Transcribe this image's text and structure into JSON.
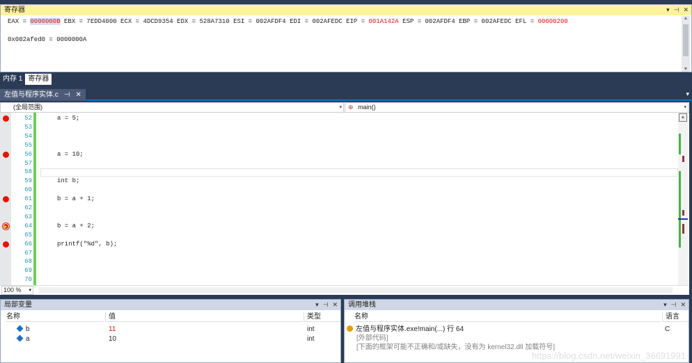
{
  "register_panel": {
    "title": "寄存器",
    "line1_segments": [
      {
        "text": "EAX = ",
        "style": "normal"
      },
      {
        "text": "0000000B",
        "style": "sel"
      },
      {
        "text": " EBX = 7EDD4000 ECX = 4DCD9354 EDX = 528A7310 ESI = 002AFDF4 EDI = 002AFEDC EIP = ",
        "style": "normal"
      },
      {
        "text": "001A142A",
        "style": "chg"
      },
      {
        "text": " ESP = 002AFDF4 EBP = 002AFEDC EFL = ",
        "style": "normal"
      },
      {
        "text": "00000200",
        "style": "chg"
      }
    ],
    "line2": "0x002afed0 = 0000000A"
  },
  "bottom_tabs": [
    "内存 1",
    "寄存器"
  ],
  "document_tab": {
    "label": "左值与程序实体.c",
    "pin": "⊣",
    "close": "✕"
  },
  "navbar": {
    "scope": "(全局范围)",
    "function": "main()"
  },
  "editor": {
    "lines": [
      {
        "num": "52",
        "code": "a = 5;",
        "bp": "bp"
      },
      {
        "num": "53",
        "code": "",
        "bp": ""
      },
      {
        "num": "54",
        "code": "",
        "bp": ""
      },
      {
        "num": "55",
        "code": "",
        "bp": ""
      },
      {
        "num": "56",
        "code": "a = 10;",
        "bp": "bp"
      },
      {
        "num": "57",
        "code": "",
        "bp": ""
      },
      {
        "num": "58",
        "code": "",
        "bp": ""
      },
      {
        "num": "59",
        "code": "int b;",
        "bp": ""
      },
      {
        "num": "60",
        "code": "",
        "bp": ""
      },
      {
        "num": "61",
        "code": "b = a + 1;",
        "bp": "bp"
      },
      {
        "num": "62",
        "code": "",
        "bp": ""
      },
      {
        "num": "63",
        "code": "",
        "bp": ""
      },
      {
        "num": "64",
        "code": "b = a + 2;",
        "bp": "cur"
      },
      {
        "num": "65",
        "code": "",
        "bp": ""
      },
      {
        "num": "66",
        "code": "printf(\"%d\", b);",
        "bp": "bp"
      },
      {
        "num": "67",
        "code": "",
        "bp": ""
      },
      {
        "num": "68",
        "code": "",
        "bp": ""
      },
      {
        "num": "69",
        "code": "",
        "bp": ""
      },
      {
        "num": "70",
        "code": "",
        "bp": ""
      }
    ],
    "zoom": "100 %"
  },
  "locals_panel": {
    "title": "局部变量",
    "columns": [
      "名称",
      "值",
      "类型"
    ],
    "rows": [
      {
        "name": "b",
        "value": "11",
        "type": "int",
        "changed": true
      },
      {
        "name": "a",
        "value": "10",
        "type": "int",
        "changed": false
      }
    ]
  },
  "callstack_panel": {
    "title": "调用堆栈",
    "columns": [
      "名称",
      "语言"
    ],
    "rows": [
      {
        "name": "左值与程序实体.exe!main(...) 行 64",
        "lang": "C",
        "current": true
      },
      {
        "name": "[外部代码]",
        "lang": "",
        "current": false
      },
      {
        "name": "[下面的框架可能不正确和/或缺失，没有为 kernel32.dll 加载符号]",
        "lang": "",
        "current": false
      }
    ]
  },
  "watermark": "https://blog.csdn.net/weixin_36691991",
  "colors": {
    "accent": "#007acc",
    "changed": "#dd1111",
    "breakpoint": "#e51400",
    "active_header": "#fff29d"
  }
}
